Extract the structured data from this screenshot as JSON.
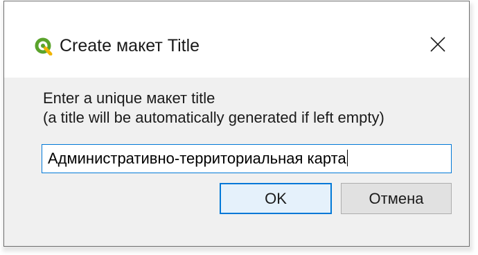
{
  "dialog": {
    "title": "Create макет Title",
    "icon": "qgis-logo-icon",
    "close_icon": "close-icon",
    "prompt_line1": "Enter a unique макет title",
    "prompt_line2": "(a title will be automatically generated if left empty)",
    "input_value": "Административно-территориальная карта",
    "ok_label": "OK",
    "cancel_label": "Отмена",
    "accent_color": "#0078d7"
  }
}
